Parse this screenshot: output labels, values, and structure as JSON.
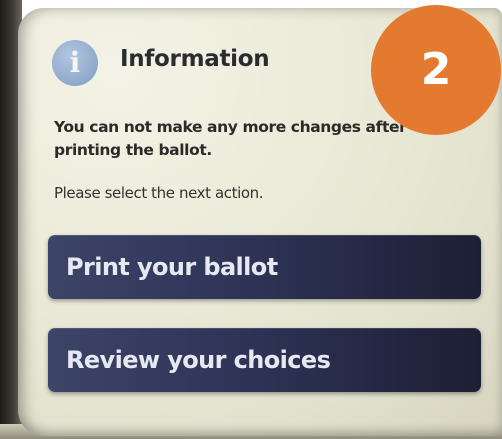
{
  "dialog": {
    "title": "Information",
    "info_icon_glyph": "i",
    "message_primary": "You can not make any more changes after printing the ballot.",
    "message_secondary": "Please select the next action."
  },
  "actions": {
    "print_label": "Print your ballot",
    "review_label": "Review your choices"
  },
  "overlay": {
    "step_number": "2"
  },
  "colors": {
    "screen_bg": "#ecebd9",
    "button_bg": "#2f3457",
    "info_icon": "#93aece",
    "step_badge": "#e37a2f"
  },
  "icons": {
    "info": "info-icon"
  }
}
